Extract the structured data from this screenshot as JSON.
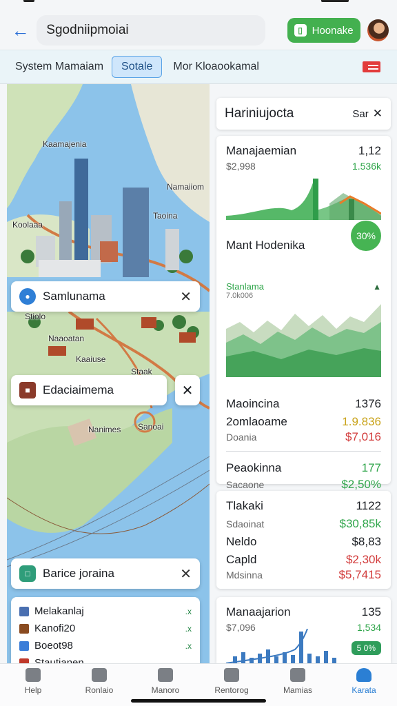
{
  "header": {
    "search_text": "Sgodniipmoiai",
    "primary_button": "Hoonake"
  },
  "tabs": [
    "System Mamaiam",
    "Sotale",
    "Mor Kloaookamal"
  ],
  "map": {
    "labels": [
      "Kaamajenia",
      "Namaiiom",
      "Koolaaa",
      "Taoina",
      "Stiolo",
      "Naaoatan",
      "Kaaiuse",
      "Staak",
      "Nanimes",
      "Sanoai"
    ],
    "cards": [
      {
        "label": "Samlunama"
      },
      {
        "label": "Edaciaimema"
      },
      {
        "label": "Barice joraina"
      }
    ],
    "legend": [
      {
        "label": "Melakanlaj",
        "tail": ".x",
        "color": "#4a6fb0"
      },
      {
        "label": "Kanofi20",
        "tail": ".x",
        "color": "#8a4b20"
      },
      {
        "label": "Boeot98",
        "tail": ".x",
        "color": "#3b7dd8"
      },
      {
        "label": "Stautianen",
        "tail": "",
        "color": "#c0392b"
      }
    ]
  },
  "panel": {
    "title": "Hariniujocta",
    "sort_label": "Sar"
  },
  "card_main": {
    "name": "Manajaemian",
    "value": "1,12",
    "amount": "$2,998",
    "change": "1.536k",
    "section_title": "Mant Hodenika",
    "badge": "30%",
    "chart_title": "Stanlama",
    "chart_sub": "7.0k006",
    "rows_a": [
      {
        "label": "Maoincina",
        "value": "1376",
        "color": "dark"
      },
      {
        "label": "2omlaoame",
        "value": "1.9.836",
        "color": "yellow"
      },
      {
        "label": "Doania",
        "value": "$7,016",
        "color": "red"
      }
    ],
    "rows_b": [
      {
        "label": "Peaokinna",
        "value": "177",
        "color": "green"
      },
      {
        "label": "Sacaone",
        "value": "$2,50%",
        "color": "green"
      }
    ]
  },
  "card_mid": {
    "rows": [
      {
        "label": "Tlakaki",
        "value": "1122",
        "color": "dark"
      },
      {
        "label": "Sdaoinat",
        "value": "$30,85k",
        "color": "green"
      },
      {
        "label": "Neldo",
        "value": "$8,83",
        "color": "dark"
      },
      {
        "label": "Capld",
        "value": "$2,30k",
        "color": "red"
      },
      {
        "label": "Mdsinna",
        "value": "$5,7415",
        "color": "red"
      }
    ]
  },
  "card_bot": {
    "name": "Manaajarion",
    "value": "135",
    "amount": "$7,096",
    "change": "1,534",
    "pill": "5 0%"
  },
  "bottom_nav": [
    "Help",
    "Ronlaio",
    "Manoro",
    "Rentorog",
    "Mamias",
    "Karata"
  ]
}
